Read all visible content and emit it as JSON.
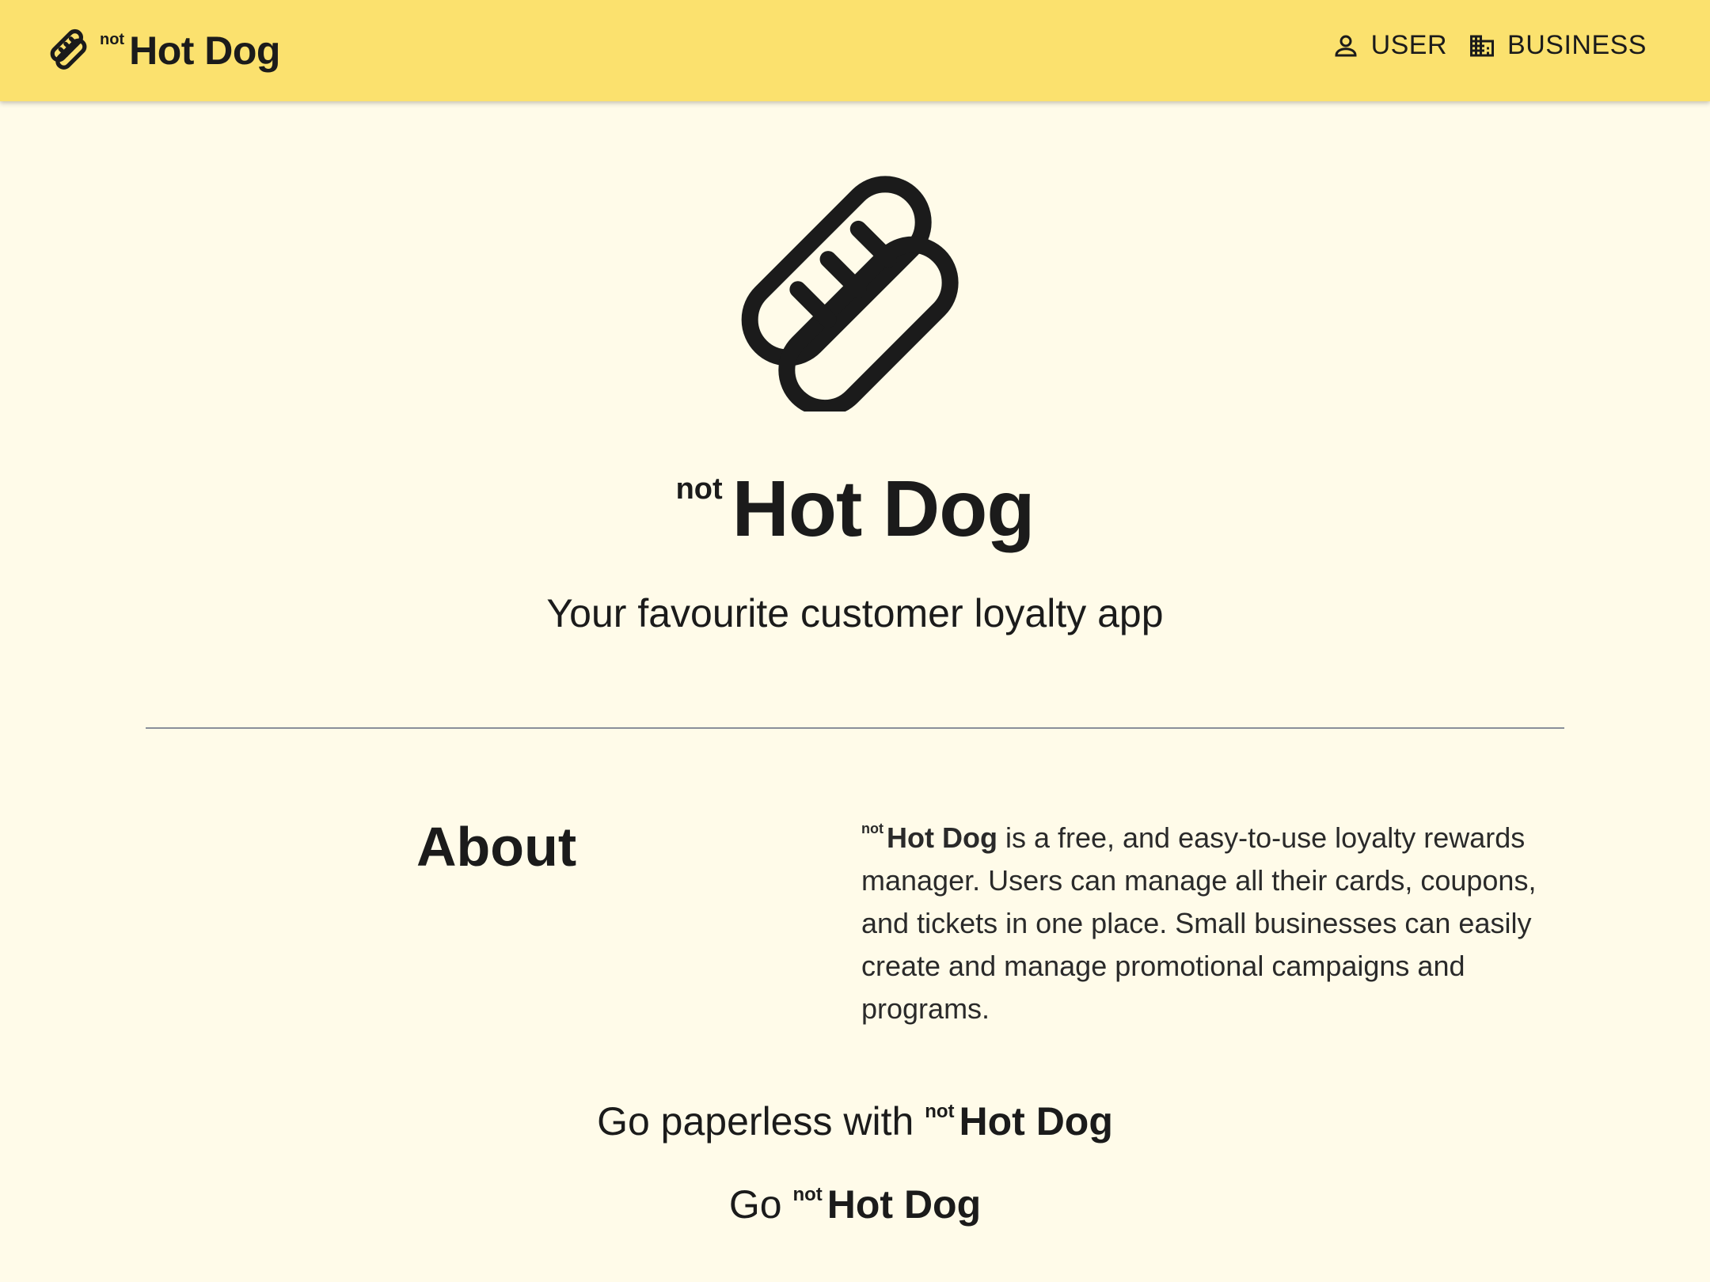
{
  "header": {
    "brand_prefix": "not",
    "brand_name": "Hot Dog",
    "nav": [
      {
        "label": "USER",
        "icon": "user-icon"
      },
      {
        "label": "BUSINESS",
        "icon": "building-icon"
      }
    ],
    "background": "#fbe16e"
  },
  "hero": {
    "logo_icon": "hotdog-icon",
    "brand_prefix": "not",
    "brand_name": "Hot Dog",
    "tagline": "Your favourite customer loyalty app"
  },
  "about": {
    "heading": "About",
    "brand_prefix": "not",
    "brand_name": "Hot Dog",
    "text": " is a free, and easy-to-use loyalty rewards manager. Users can manage all their cards, coupons, and tickets in one place. Small businesses can easily create and manage promotional campaigns and programs."
  },
  "slogans": {
    "paperless_prefix": "Go paperless with ",
    "go_prefix": "Go ",
    "brand_prefix": "not",
    "brand_name": "Hot Dog"
  },
  "colors": {
    "page_background": "#fffbe9",
    "text": "#1b1b1b",
    "divider": "#8a8f9a"
  }
}
